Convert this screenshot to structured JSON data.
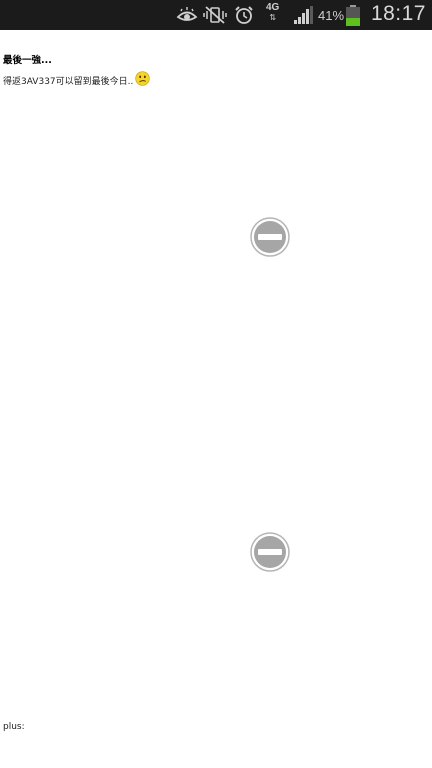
{
  "status_bar": {
    "time": "18:17",
    "battery_percent": "41%",
    "network_type": "4G",
    "network_arrows": "⇅",
    "icons": [
      "eye-icon",
      "mute-icon",
      "alarm-icon",
      "network-4g-icon",
      "signal-icon",
      "battery-icon"
    ],
    "battery_color": "#5fbf1f"
  },
  "post": {
    "title": "最後一強...",
    "message": "得返3AV337可以留到最後今日..",
    "emoji": "confused-face-icon"
  },
  "blocked_images": [
    {
      "icon": "blocked-image-icon"
    },
    {
      "icon": "blocked-image-icon"
    }
  ],
  "footer": {
    "label": "plus:"
  }
}
